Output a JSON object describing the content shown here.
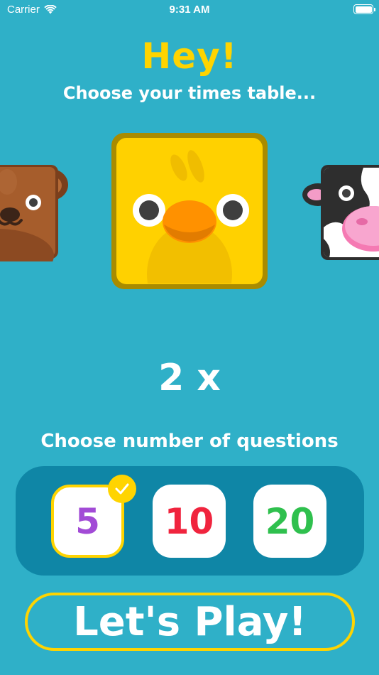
{
  "status_bar": {
    "carrier": "Carrier",
    "time": "9:31 AM"
  },
  "header": {
    "title": "Hey!",
    "subtitle": "Choose your times table..."
  },
  "carousel": {
    "animals": [
      {
        "name": "bear",
        "position": "left"
      },
      {
        "name": "chick",
        "position": "center",
        "selected": true
      },
      {
        "name": "cow",
        "position": "right"
      }
    ]
  },
  "times_table": {
    "value": "2 x"
  },
  "questions": {
    "label": "Choose number of questions",
    "options": [
      "5",
      "10",
      "20"
    ],
    "selected": "5"
  },
  "play_button": {
    "label": "Let's Play!"
  },
  "colors": {
    "background": "#2fb0c8",
    "accent": "#ffd400",
    "panel": "#0f86a6",
    "option_5": "#a24bd6",
    "option_10": "#f0243e",
    "option_20": "#2fc04e"
  }
}
